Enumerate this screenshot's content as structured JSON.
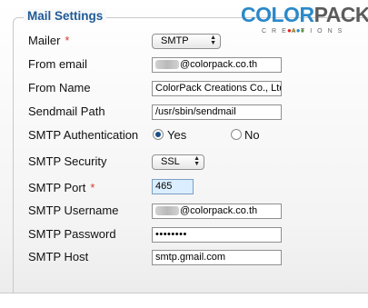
{
  "fieldset": {
    "legend": "Mail Settings"
  },
  "logo": {
    "brand_color": "COLOR",
    "brand_pack": "PACK",
    "subtitle": "CREATIONS"
  },
  "fields": {
    "mailer": {
      "label": "Mailer",
      "required_mark": "*",
      "value": "SMTP"
    },
    "from_email": {
      "label": "From email",
      "value": "@colorpack.co.th"
    },
    "from_name": {
      "label": "From Name",
      "value": "ColorPack Creations Co., Ltd"
    },
    "sendmail_path": {
      "label": "Sendmail Path",
      "value": "/usr/sbin/sendmail"
    },
    "smtp_auth": {
      "label": "SMTP Authentication",
      "yes_label": "Yes",
      "no_label": "No",
      "selected": "Yes"
    },
    "smtp_security": {
      "label": "SMTP Security",
      "value": "SSL"
    },
    "smtp_port": {
      "label": "SMTP Port",
      "required_mark": "*",
      "value": "465"
    },
    "smtp_username": {
      "label": "SMTP Username",
      "value": "@colorpack.co.th"
    },
    "smtp_password": {
      "label": "SMTP Password",
      "value": "••••••••"
    },
    "smtp_host": {
      "label": "SMTP Host",
      "value": "smtp.gmail.com"
    }
  },
  "colors": {
    "legend": "#1f5a96",
    "required": "#d73b2a",
    "logo_blue": "#2a89c9",
    "port_highlight": "#dbeeff"
  }
}
